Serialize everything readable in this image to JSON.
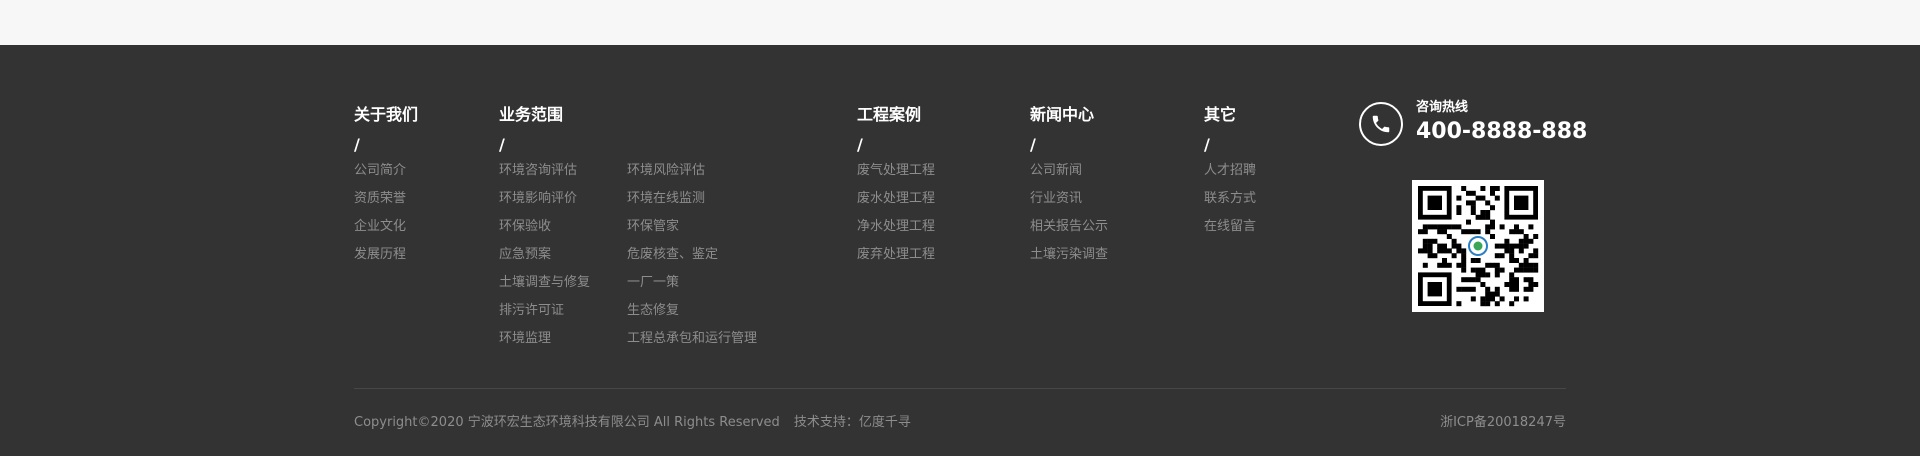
{
  "columns": {
    "about": {
      "title": "关于我们",
      "slash": "/",
      "links": [
        "公司简介",
        "资质荣誉",
        "企业文化",
        "发展历程"
      ]
    },
    "business": {
      "title": "业务范围",
      "slash": "/",
      "links_left": [
        "环境咨询评估",
        "环境影响评价",
        "环保验收",
        "应急预案",
        "土壤调查与修复",
        "排污许可证",
        "环境监理"
      ],
      "links_right": [
        "环境风险评估",
        "环境在线监测",
        "环保管家",
        "危废核查、鉴定",
        "一厂一策",
        "生态修复",
        "工程总承包和运行管理"
      ]
    },
    "cases": {
      "title": "工程案例",
      "slash": "/",
      "links": [
        "废气处理工程",
        "废水处理工程",
        "净水处理工程",
        "废弃处理工程"
      ]
    },
    "news": {
      "title": "新闻中心",
      "slash": "/",
      "links": [
        "公司新闻",
        "行业资讯",
        "相关报告公示",
        "土壤污染调查"
      ]
    },
    "other": {
      "title": "其它",
      "slash": "/",
      "links": [
        "人才招聘",
        "联系方式",
        "在线留言"
      ]
    }
  },
  "contact": {
    "hotline_label": "咨询热线",
    "hotline_number": "400-8888-888",
    "phone_icon": "phone-icon",
    "qr_icon": "qr-code"
  },
  "bottom": {
    "copyright": "Copyright©2020 宁波环宏生态环境科技有限公司 All Rights Reserved",
    "tech_support": "技术支持：亿度千寻",
    "icp": "浙ICP备20018247号"
  },
  "colors": {
    "footer_bg": "#333333",
    "top_bg": "#f7f7f7",
    "title_text": "#ffffff",
    "link_text": "#8d8d8d",
    "divider": "#474747"
  }
}
